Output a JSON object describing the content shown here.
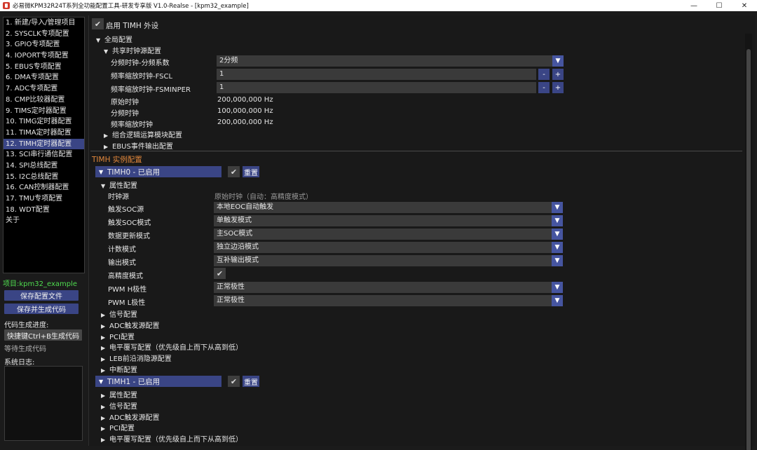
{
  "window": {
    "title": "必易微KPM32R24T系列全功能配置工具-研发专享版 V1.0-Realse - [kpm32_example]",
    "minimize": "—",
    "maximize": "☐",
    "close": "✕"
  },
  "nav": {
    "items": [
      "1. 新建/导入/管理项目",
      "2. SYSCLK专项配置",
      "3. GPIO专项配置",
      "4. IOPORT专项配置",
      "5. EBUS专项配置",
      "6. DMA专项配置",
      "7. ADC专项配置",
      "8. CMP比较器配置",
      "9. TIMS定时器配置",
      "10. TIMG定时器配置",
      "11. TIMA定时器配置",
      "12. TIMH定时器配置",
      "13. SCI串行通信配置",
      "14. SPI总线配置",
      "15. I2C总线配置",
      "16. CAN控制器配置",
      "17. TMU专项配置",
      "18. WDT配置",
      "关于"
    ],
    "active_index": 11
  },
  "sidebar": {
    "project_label": "项目:kpm32_example",
    "save_config": "保存配置文件",
    "save_generate": "保存并生成代码",
    "progress_label": "代码生成进度:",
    "shortcut_button": "快捷键Ctrl+B生成代码",
    "waiting": "等待生成代码",
    "log_label": "系统日志:"
  },
  "main": {
    "enable_label": "启用 TIMH 外设",
    "global_config": "全局配置",
    "shared_clock": "共享时钟源配置",
    "div_label": "分频时钟-分频系数",
    "div_value": "2分频",
    "fscl_label": "频率缩放时钟-FSCL",
    "fscl_value": "1",
    "fsminper_label": "频率缩放时钟-FSMINPER",
    "fsminper_value": "1",
    "minus": "-",
    "plus": "+",
    "orig_clk_label": "原始时钟",
    "orig_clk_value": "200,000,000 Hz",
    "div_clk_label": "分频时钟",
    "div_clk_value": "100,000,000 Hz",
    "scale_clk_label": "频率缩放时钟",
    "scale_clk_value": "200,000,000 Hz",
    "comb_logic": "组合逻辑运算模块配置",
    "ebus_event": "EBUS事件输出配置",
    "instance_section": "TIMH 实例配置",
    "reset": "重置",
    "timh0": {
      "header": "TIMH0 - 已启用",
      "attr_config": "属性配置",
      "clk_src_label": "时钟源",
      "clk_src_value": "原始时钟（自动：高精度模式）",
      "soc_src_label": "触发SOC源",
      "soc_src_value": "本地EOC自动触发",
      "soc_mode_label": "触发SOC模式",
      "soc_mode_value": "单触发模式",
      "update_mode_label": "数据更新模式",
      "update_mode_value": "主SOC模式",
      "count_mode_label": "计数模式",
      "count_mode_value": "独立边沿模式",
      "output_mode_label": "输出模式",
      "output_mode_value": "互补输出模式",
      "hires_label": "高精度模式",
      "pwmh_label": "PWM H极性",
      "pwmh_value": "正常极性",
      "pwml_label": "PWM L极性",
      "pwml_value": "正常极性",
      "sub": [
        "信号配置",
        "ADC触发源配置",
        "PCI配置",
        "电平覆写配置（优先级自上而下从高到低）",
        "LEB前沿消隐源配置",
        "中断配置"
      ]
    },
    "timh1": {
      "header": "TIMH1 - 已启用",
      "sub": [
        "属性配置",
        "信号配置",
        "ADC触发源配置",
        "PCI配置",
        "电平覆写配置（优先级自上而下从高到低）"
      ]
    }
  },
  "colors": {
    "accent": "#3a4585",
    "section_orange": "#e3883c",
    "project_green": "#4fdc4f"
  }
}
